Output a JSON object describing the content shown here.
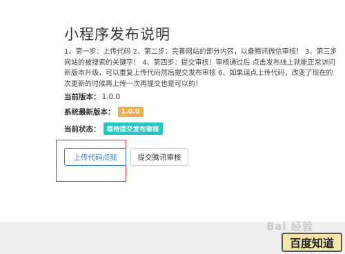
{
  "page": {
    "title": "小程序发布说明",
    "description_lines": [
      "1、第一步：上传代码 2、第二步：完善网站的部分内容，以备腾讯微信审核！ 3、第三步",
      "网站的被搜索的关键字！ 4、第四步：提交审核！审核通过后 点击发布线上就能正常访问",
      "新版本升级，可以重复上传代码然后提交发布审核 6、如果误点上传代码，改变了现在的",
      "次更新的时候再上传一次再提交也是可以的！"
    ]
  },
  "info": {
    "current_version_label": "当前版本：",
    "current_version_value": "1.0.0",
    "latest_version_label": "系统最新版本：",
    "latest_version_value": "1.0.0",
    "status_label": "当前状态：",
    "status_value": "等待提交发布审核"
  },
  "buttons": {
    "upload_label": "上传代码点我",
    "submit_label": "提交腾讯审核"
  },
  "watermark": {
    "logo_text": "Bai 经验",
    "site_text": "百度知道"
  },
  "colors": {
    "version_badge": "#f0ad4e",
    "status_badge": "#26c6c6",
    "highlight": "#e03030",
    "primary": "#2a7fd1"
  }
}
